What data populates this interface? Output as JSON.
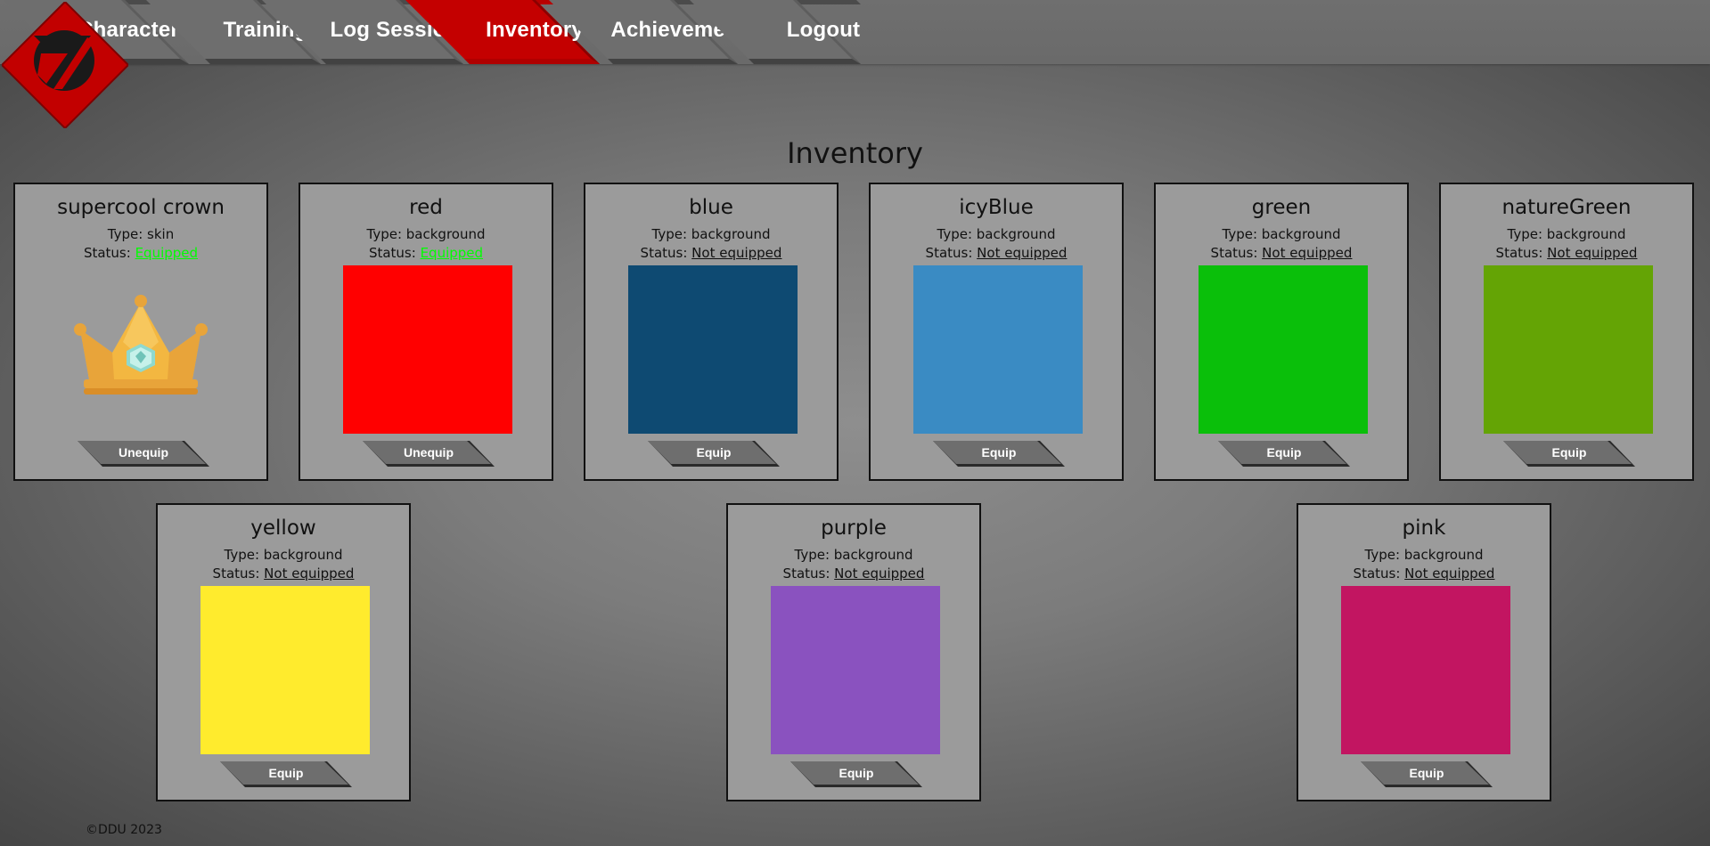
{
  "nav": {
    "logo_icon": "ddu-logo-icon",
    "items": [
      {
        "label": "Character",
        "active": false
      },
      {
        "label": "Training",
        "active": false
      },
      {
        "label": "Log Session",
        "active": false
      },
      {
        "label": "Inventory",
        "active": true
      },
      {
        "label": "Achievements",
        "active": false
      },
      {
        "label": "Logout",
        "active": false
      }
    ],
    "colors": {
      "active": "#c40000",
      "bar": "#6e6e6e"
    }
  },
  "page": {
    "title": "Inventory"
  },
  "labels": {
    "type_prefix": "Type: ",
    "status_prefix": "Status: "
  },
  "items": [
    {
      "name": "supercool crown",
      "type": "skin",
      "status": "Equipped",
      "button": "Unequip",
      "image": "crown-icon"
    },
    {
      "name": "red",
      "type": "background",
      "status": "Equipped",
      "button": "Unequip",
      "color": "#ff0000"
    },
    {
      "name": "blue",
      "type": "background",
      "status": "Not equipped",
      "button": "Equip",
      "color": "#0e4a72"
    },
    {
      "name": "icyBlue",
      "type": "background",
      "status": "Not equipped",
      "button": "Equip",
      "color": "#3a8bc3"
    },
    {
      "name": "green",
      "type": "background",
      "status": "Not equipped",
      "button": "Equip",
      "color": "#0abf0a"
    },
    {
      "name": "natureGreen",
      "type": "background",
      "status": "Not equipped",
      "button": "Equip",
      "color": "#64a405"
    },
    {
      "name": "yellow",
      "type": "background",
      "status": "Not equipped",
      "button": "Equip",
      "color": "#ffeb2d"
    },
    {
      "name": "purple",
      "type": "background",
      "status": "Not equipped",
      "button": "Equip",
      "color": "#8a52bf"
    },
    {
      "name": "pink",
      "type": "background",
      "status": "Not equipped",
      "button": "Equip",
      "color": "#c21561"
    }
  ],
  "footer": {
    "text": "©DDU 2023"
  }
}
